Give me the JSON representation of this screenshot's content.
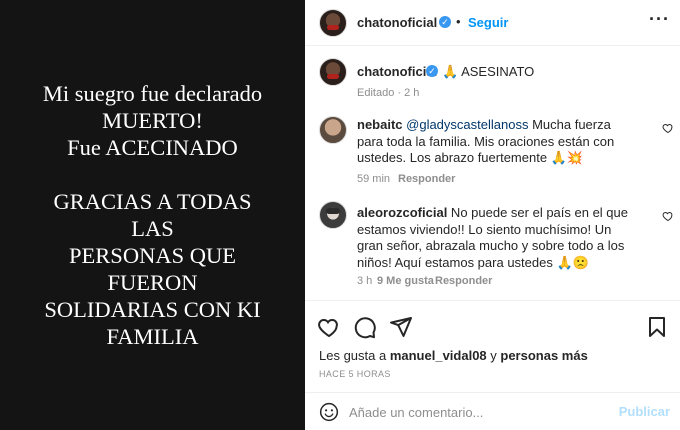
{
  "post_image": {
    "lines": [
      "Mi suegro fue declarado",
      "MUERTO!",
      "Fue ACECINADO",
      "",
      "GRACIAS A TODAS",
      "LAS",
      "PERSONAS QUE",
      "FUERON",
      "SOLIDARIAS CON KI",
      "FAMILIA"
    ]
  },
  "header": {
    "username": "chatonoficial",
    "separator": "•",
    "follow_label": "Seguir",
    "more_label": "···"
  },
  "caption": {
    "username": "chatonoficial",
    "text": "🙏 ASESINATO",
    "meta": "Editado · 2 h"
  },
  "comments": [
    {
      "username": "nebaitc",
      "mention": "@gladyscastellanoss",
      "text": " Mucha fuerza para toda la familia. Mis oraciones están con ustedes. Los abrazo fuertemente 🙏💥",
      "time": "59 min",
      "reply_label": "Responder",
      "likes": ""
    },
    {
      "username": "aleorozcoficial",
      "mention": "",
      "text": " No puede ser el país en el que estamos viviendo!! Lo siento muchísimo! Un gran señor, abrazala mucho y sobre todo a los niños! Aquí estamos para ustedes 🙏🙁",
      "time": "3 h",
      "likes": "9 Me gusta",
      "reply_label": "Responder"
    }
  ],
  "likes": {
    "prefix": "Les gusta a ",
    "user": "manuel_vidal08",
    "middle": " y ",
    "others": "personas más"
  },
  "timestamp": "HACE 5 HORAS",
  "comment_box": {
    "placeholder": "Añade un comentario...",
    "publish_label": "Publicar"
  },
  "colors": {
    "link_blue": "#0095f6",
    "verified_blue": "#3897f0",
    "muted": "#8e8e8e",
    "publish_disabled": "#b2dffc"
  }
}
